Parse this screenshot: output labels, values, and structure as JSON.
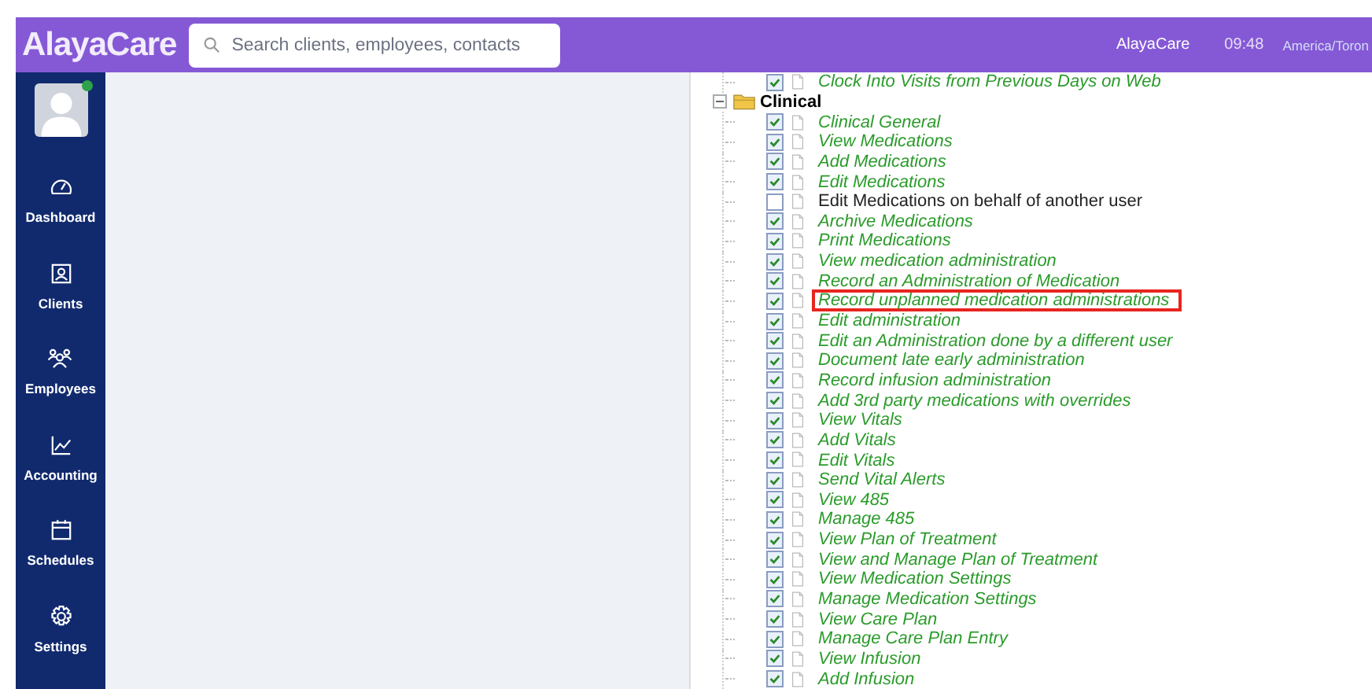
{
  "header": {
    "logo": "AlayaCare",
    "search": {
      "placeholder": "Search clients, employees, contacts"
    },
    "user": "AlayaCare",
    "time": "09:48",
    "timezone": "America/Toron"
  },
  "sidebar": {
    "items": [
      {
        "label": "Dashboard"
      },
      {
        "label": "Clients"
      },
      {
        "label": "Employees"
      },
      {
        "label": "Accounting"
      },
      {
        "label": "Schedules"
      },
      {
        "label": "Settings"
      }
    ]
  },
  "tree": {
    "top_item": {
      "label": "Clock Into Visits from Previous Days on Web",
      "checked": true,
      "highlighted": false
    },
    "folder": {
      "label": "Clinical",
      "expanded": true,
      "children": [
        {
          "label": "Clinical General",
          "checked": true,
          "highlighted": false
        },
        {
          "label": "View Medications",
          "checked": true,
          "highlighted": false
        },
        {
          "label": "Add Medications",
          "checked": true,
          "highlighted": false
        },
        {
          "label": "Edit Medications",
          "checked": true,
          "highlighted": false
        },
        {
          "label": "Edit Medications on behalf of another user",
          "checked": false,
          "highlighted": false
        },
        {
          "label": "Archive Medications",
          "checked": true,
          "highlighted": false
        },
        {
          "label": "Print Medications",
          "checked": true,
          "highlighted": false
        },
        {
          "label": "View medication administration",
          "checked": true,
          "highlighted": false
        },
        {
          "label": "Record an Administration of Medication",
          "checked": true,
          "highlighted": false
        },
        {
          "label": "Record unplanned medication administrations",
          "checked": true,
          "highlighted": true
        },
        {
          "label": "Edit administration",
          "checked": true,
          "highlighted": false
        },
        {
          "label": "Edit an Administration done by a different user",
          "checked": true,
          "highlighted": false
        },
        {
          "label": "Document late early administration",
          "checked": true,
          "highlighted": false
        },
        {
          "label": "Record infusion administration",
          "checked": true,
          "highlighted": false
        },
        {
          "label": "Add 3rd party medications with overrides",
          "checked": true,
          "highlighted": false
        },
        {
          "label": "View Vitals",
          "checked": true,
          "highlighted": false
        },
        {
          "label": "Add Vitals",
          "checked": true,
          "highlighted": false
        },
        {
          "label": "Edit Vitals",
          "checked": true,
          "highlighted": false
        },
        {
          "label": "Send Vital Alerts",
          "checked": true,
          "highlighted": false
        },
        {
          "label": "View 485",
          "checked": true,
          "highlighted": false
        },
        {
          "label": "Manage 485",
          "checked": true,
          "highlighted": false
        },
        {
          "label": "View Plan of Treatment",
          "checked": true,
          "highlighted": false
        },
        {
          "label": "View and Manage Plan of Treatment",
          "checked": true,
          "highlighted": false
        },
        {
          "label": "View Medication Settings",
          "checked": true,
          "highlighted": false
        },
        {
          "label": "Manage Medication Settings",
          "checked": true,
          "highlighted": false
        },
        {
          "label": "View Care Plan",
          "checked": true,
          "highlighted": false
        },
        {
          "label": "Manage Care Plan Entry",
          "checked": true,
          "highlighted": false
        },
        {
          "label": "View Infusion",
          "checked": true,
          "highlighted": false
        },
        {
          "label": "Add Infusion",
          "checked": true,
          "highlighted": false
        }
      ]
    }
  }
}
